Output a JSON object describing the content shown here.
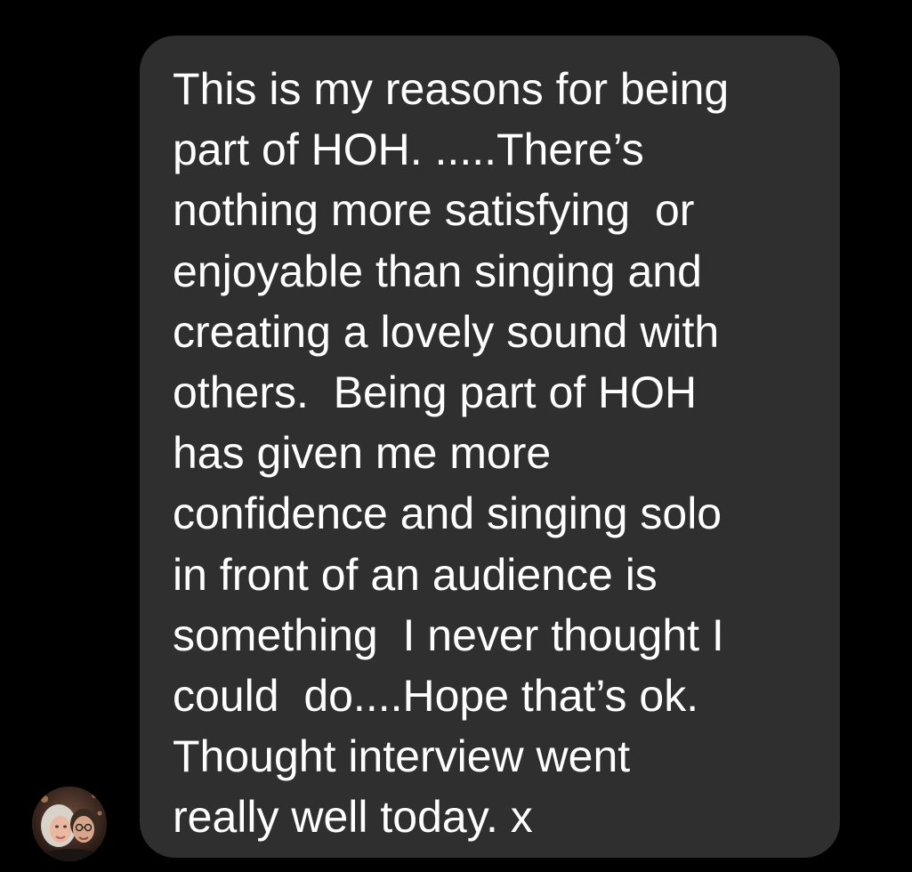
{
  "conversation": {
    "message": {
      "lines": [
        "This is my reasons for being",
        "part of HOH. .....There’s",
        "nothing more satisfying  or",
        "enjoyable than singing and",
        "creating a lovely sound with",
        "others.  Being part of HOH",
        "has given me more",
        "confidence and singing solo",
        "in front of an audience is",
        "something  I never thought I",
        "could  do....Hope that’s ok.",
        "Thought interview went",
        "really well today. x"
      ]
    },
    "sender_avatar": {
      "icon": "profile-photo-icon"
    }
  },
  "colors": {
    "background": "#000000",
    "bubble": "#2f2f2f",
    "text": "#ffffff"
  }
}
